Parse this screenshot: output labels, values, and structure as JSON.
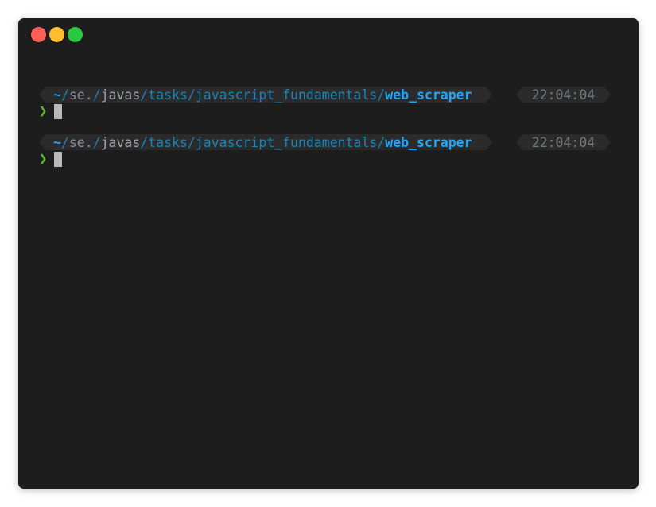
{
  "window": {
    "controls": [
      "close",
      "minimize",
      "maximize"
    ]
  },
  "prompts": [
    {
      "path": {
        "home": "~",
        "seg1": "se.",
        "sep1": "/",
        "seg2": "javas",
        "sep2": "/",
        "seg3": "tasks",
        "sep3": "/",
        "seg4": "javascript_fundamentals",
        "sep4": "/",
        "current": "web_scraper"
      },
      "time": "22:04:04",
      "symbol": "❯"
    },
    {
      "path": {
        "home": "~",
        "seg1": "se.",
        "sep1": "/",
        "seg2": "javas",
        "sep2": "/",
        "seg3": "tasks",
        "sep3": "/",
        "seg4": "javascript_fundamentals",
        "sep4": "/",
        "current": "web_scraper"
      },
      "time": "22:04:04",
      "symbol": "❯"
    }
  ],
  "colors": {
    "background": "#1d1d1d",
    "segment": "#2b2b2b",
    "accent": "#1fa6ff",
    "chevron": "#5ac024",
    "time": "#727c80"
  }
}
